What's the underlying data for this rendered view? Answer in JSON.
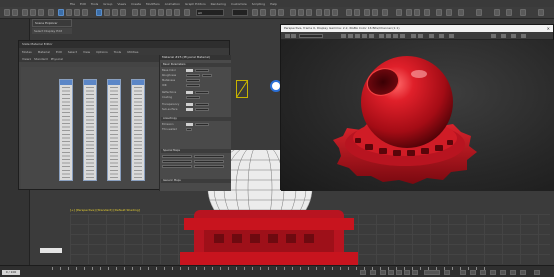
{
  "menubar": {
    "items": [
      "File",
      "Edit",
      "Tools",
      "Group",
      "Views",
      "Create",
      "Modifiers",
      "Animation",
      "Graph Editors",
      "Rendering",
      "Customize",
      "Scripting",
      "Help"
    ]
  },
  "toolbar": {
    "selection_filter": "All",
    "view_dropdown": "View"
  },
  "scene_explorer": {
    "title": "Scene Explorer",
    "subtitle": "Select  Display  Edit"
  },
  "material_editor": {
    "title": "Slate Material Editor",
    "menu": [
      "Modes",
      "Material",
      "Edit",
      "Select",
      "View",
      "Options",
      "Tools",
      "Utilities"
    ],
    "tabs": [
      "View1",
      "Standard",
      "Physical"
    ],
    "panel_title": "Material #25 (Physical Material)",
    "rollouts": [
      "Basic Parameters",
      "Anisotropy",
      "Special Maps",
      "Generic Maps"
    ],
    "params": [
      "Base Color",
      "Roughness",
      "Metalness",
      "IOR",
      "Reflections",
      "Coating",
      "Transparency",
      "Sub-surface",
      "Emission",
      "Thin-walled"
    ]
  },
  "render_window": {
    "title": "Perspective, frame 0, Display Gamma: 2.2, RGBA Color 16 Bits/Channel (1:1)"
  },
  "viewport": {
    "label": "[+] [Perspective] [Standard] [Default Shading]"
  },
  "timeline": {
    "frame_display": "0 / 100"
  },
  "colors": {
    "accent": "#3c6ea8",
    "material_red": "#c8141e",
    "viewport_bg": "#3b3b3b",
    "selection_yellow": "#c8b400"
  }
}
